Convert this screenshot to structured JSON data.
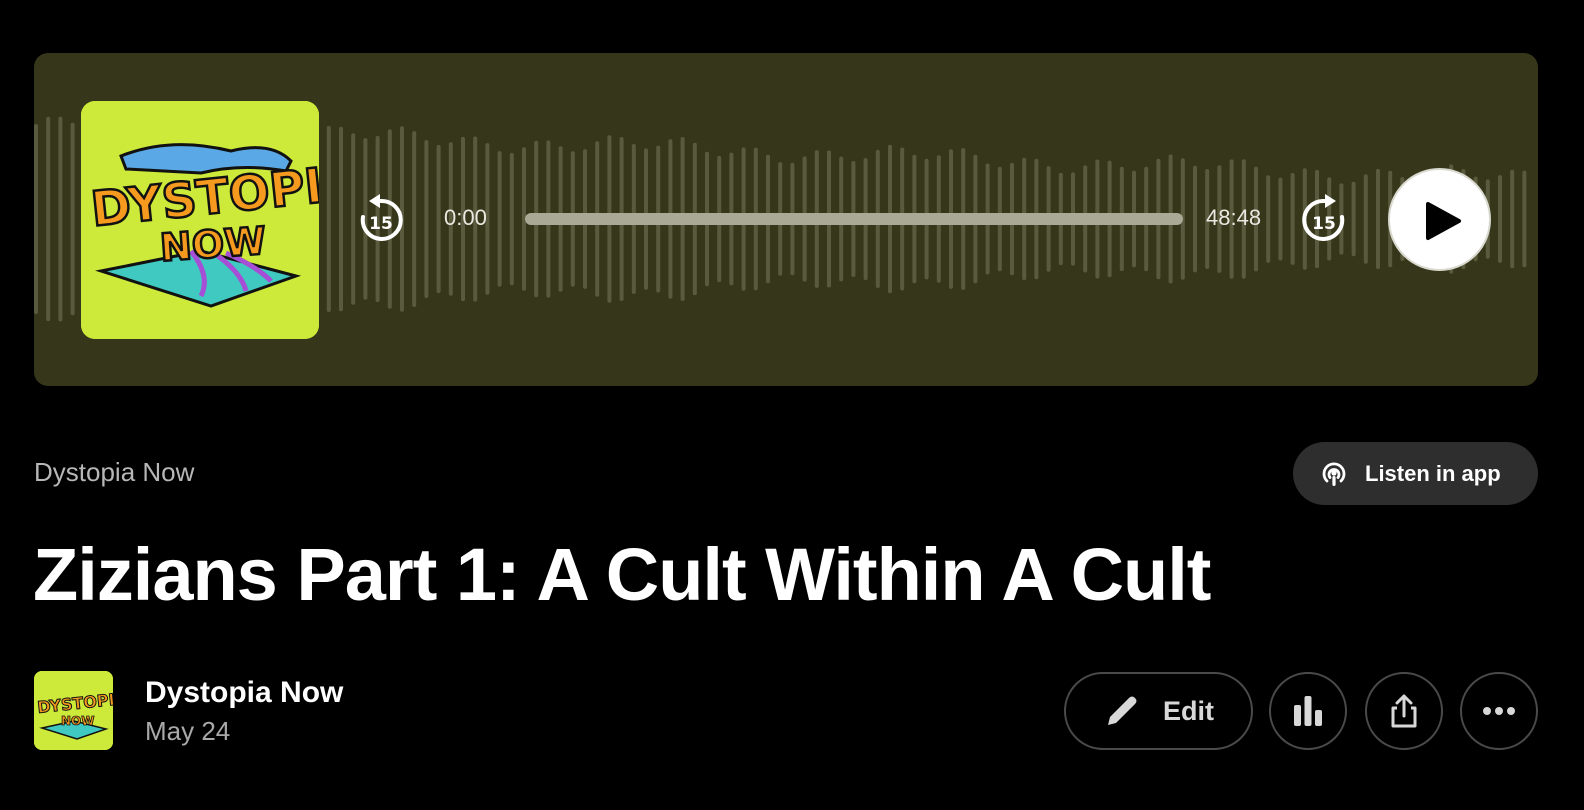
{
  "player": {
    "artwork_alt": "Dystopia Now cover art",
    "artwork_text": [
      "DYSTOPIA",
      "NOW"
    ],
    "skip_back_label": "15",
    "skip_forward_label": "15",
    "current_time": "0:00",
    "duration": "48:48",
    "progress_fraction": 0,
    "play_icon": "play-icon",
    "colors": {
      "background": "#36371a",
      "waveform": "#5a5b3e",
      "artwork_bg": "#cde93a"
    }
  },
  "episode": {
    "show_link": "Dystopia Now",
    "title": "Zizians Part 1: A Cult Within A Cult",
    "show_name": "Dystopia Now",
    "date": "May 24"
  },
  "actions": {
    "listen_in_app_label": "Listen in app",
    "listen_icon": "podcast-icon",
    "edit_label": "Edit",
    "edit_icon": "pencil-icon",
    "stats_icon": "bar-chart-icon",
    "share_icon": "share-icon",
    "more_icon": "more-icon"
  }
}
